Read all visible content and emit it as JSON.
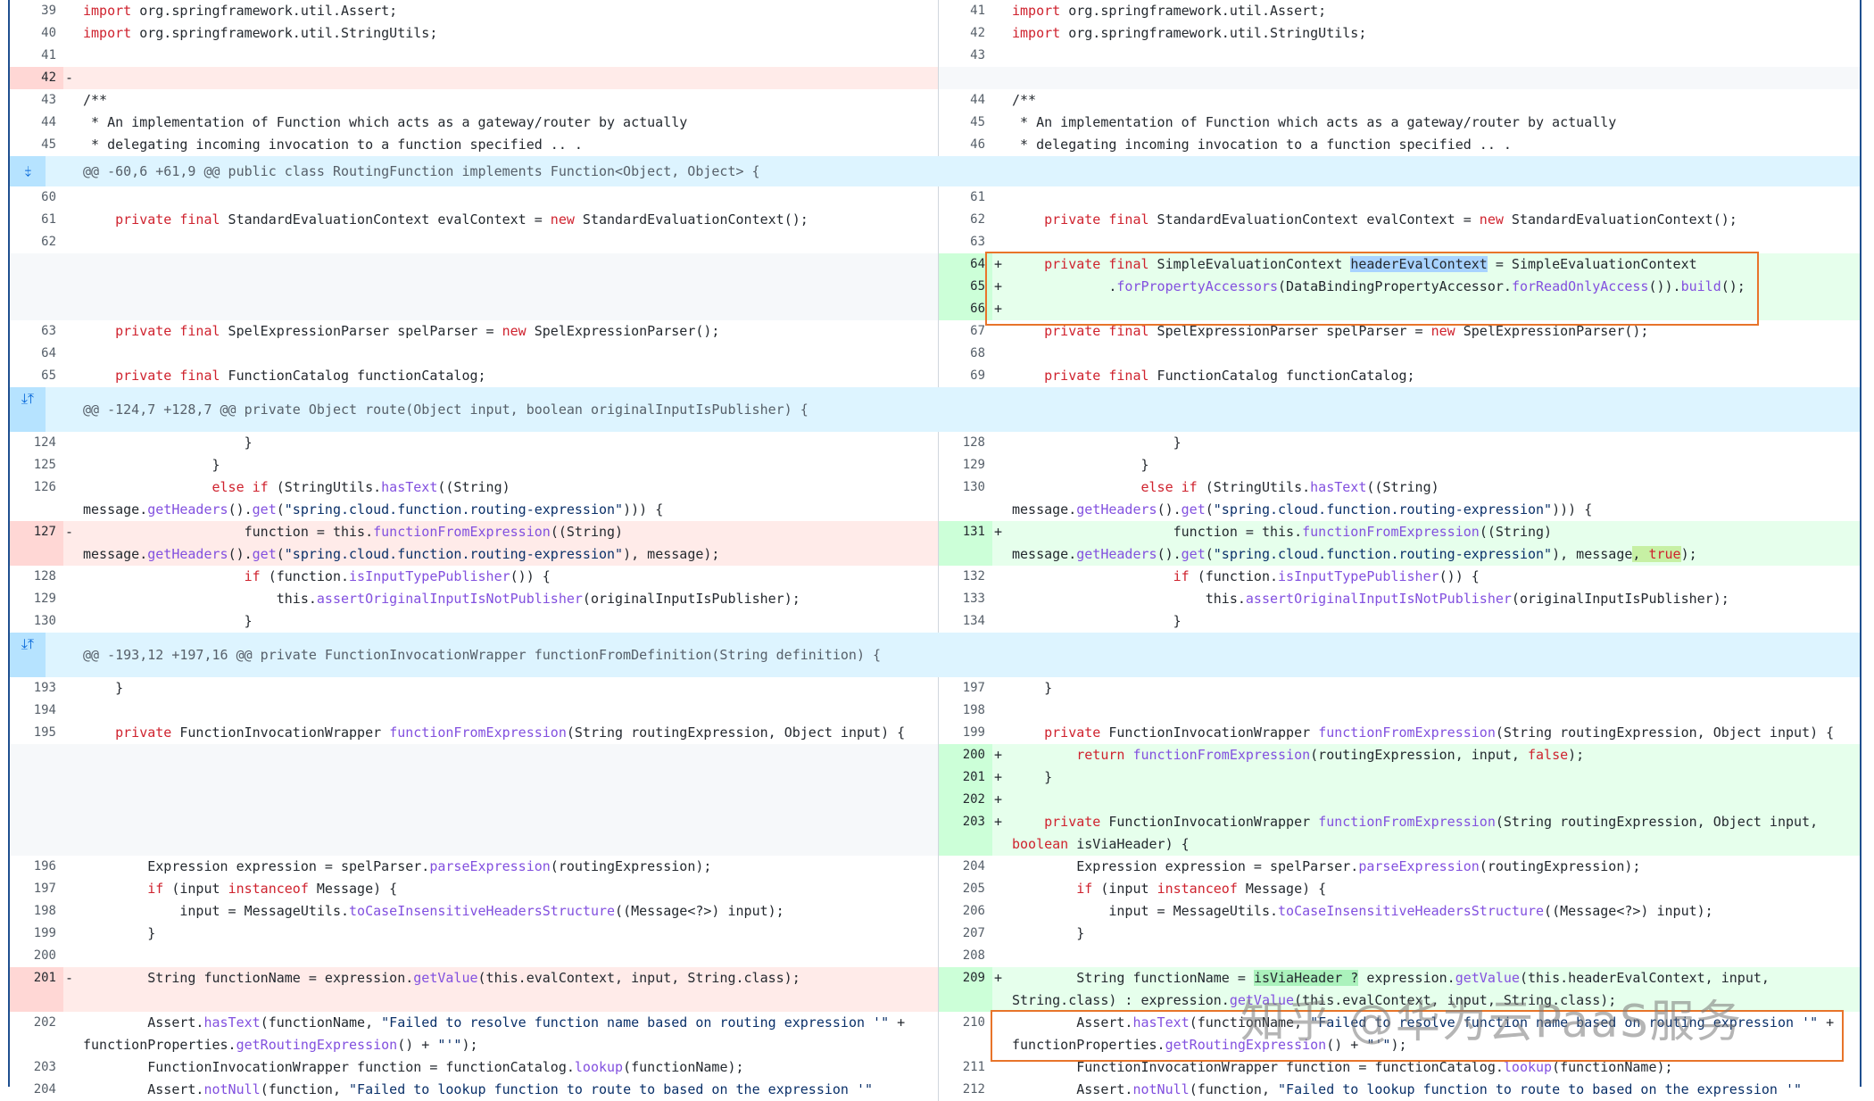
{
  "watermark": "知乎 @华为云PaaS服务",
  "colors": {
    "addition": "#e6ffec",
    "deletion": "#ffebe9",
    "hunk": "#ddf4ff",
    "highlight_box": "#e8742a"
  },
  "rows": [
    {
      "type": "code",
      "h": 25,
      "left": {
        "num": "39",
        "t": "ctx",
        "code": "import org.springframework.util.Assert;"
      },
      "right": {
        "num": "41",
        "t": "ctx",
        "code": "import org.springframework.util.Assert;"
      }
    },
    {
      "type": "code",
      "h": 25,
      "left": {
        "num": "40",
        "t": "ctx",
        "code": "import org.springframework.util.StringUtils;"
      },
      "right": {
        "num": "42",
        "t": "ctx",
        "code": "import org.springframework.util.StringUtils;"
      }
    },
    {
      "type": "code",
      "h": 25,
      "left": {
        "num": "41",
        "t": "ctx",
        "code": ""
      },
      "right": {
        "num": "43",
        "t": "ctx",
        "code": ""
      }
    },
    {
      "type": "code",
      "h": 25,
      "left": {
        "num": "42",
        "t": "del",
        "sign": "-",
        "code": ""
      },
      "right": {
        "t": "empty"
      }
    },
    {
      "type": "code",
      "h": 25,
      "left": {
        "num": "43",
        "t": "ctx",
        "code": "/**"
      },
      "right": {
        "num": "44",
        "t": "ctx",
        "code": "/**"
      }
    },
    {
      "type": "code",
      "h": 25,
      "left": {
        "num": "44",
        "t": "ctx",
        "code": " * An implementation of Function which acts as a gateway/router by actually"
      },
      "right": {
        "num": "45",
        "t": "ctx",
        "code": " * An implementation of Function which acts as a gateway/router by actually"
      }
    },
    {
      "type": "code",
      "h": 25,
      "left": {
        "num": "45",
        "t": "ctx",
        "code": " * delegating incoming invocation to a function specified .. ."
      },
      "right": {
        "num": "46",
        "t": "ctx",
        "code": " * delegating incoming invocation to a function specified .. ."
      }
    },
    {
      "type": "hunk",
      "h": 34,
      "icon": "⤈",
      "text": "@@ -60,6 +61,9 @@ public class RoutingFunction implements Function<Object, Object> {"
    },
    {
      "type": "code",
      "h": 25,
      "left": {
        "num": "60",
        "t": "ctx",
        "code": ""
      },
      "right": {
        "num": "61",
        "t": "ctx",
        "code": ""
      }
    },
    {
      "type": "code",
      "h": 25,
      "left": {
        "num": "61",
        "t": "ctx",
        "code": "    private final StandardEvaluationContext evalContext = new StandardEvaluationContext();"
      },
      "right": {
        "num": "62",
        "t": "ctx",
        "code": "    private final StandardEvaluationContext evalContext = new StandardEvaluationContext();"
      }
    },
    {
      "type": "code",
      "h": 25,
      "left": {
        "num": "62",
        "t": "ctx",
        "code": ""
      },
      "right": {
        "num": "63",
        "t": "ctx",
        "code": ""
      }
    },
    {
      "type": "code",
      "h": 25,
      "left": {
        "t": "empty"
      },
      "right": {
        "num": "64",
        "t": "add",
        "sign": "+",
        "code": "    private final SimpleEvaluationContext headerEvalContext = SimpleEvaluationContext"
      }
    },
    {
      "type": "code",
      "h": 25,
      "left": {
        "t": "empty"
      },
      "right": {
        "num": "65",
        "t": "add",
        "sign": "+",
        "code": "            .forPropertyAccessors(DataBindingPropertyAccessor.forReadOnlyAccess()).build();"
      }
    },
    {
      "type": "code",
      "h": 25,
      "left": {
        "t": "empty"
      },
      "right": {
        "num": "66",
        "t": "add",
        "sign": "+",
        "code": ""
      }
    },
    {
      "type": "code",
      "h": 25,
      "left": {
        "num": "63",
        "t": "ctx",
        "code": "    private final SpelExpressionParser spelParser = new SpelExpressionParser();"
      },
      "right": {
        "num": "67",
        "t": "ctx",
        "code": "    private final SpelExpressionParser spelParser = new SpelExpressionParser();"
      }
    },
    {
      "type": "code",
      "h": 25,
      "left": {
        "num": "64",
        "t": "ctx",
        "code": ""
      },
      "right": {
        "num": "68",
        "t": "ctx",
        "code": ""
      }
    },
    {
      "type": "code",
      "h": 25,
      "left": {
        "num": "65",
        "t": "ctx",
        "code": "    private final FunctionCatalog functionCatalog;"
      },
      "right": {
        "num": "69",
        "t": "ctx",
        "code": "    private final FunctionCatalog functionCatalog;"
      }
    },
    {
      "type": "hunk",
      "h": 50,
      "icon": "⤓⤒",
      "text": "@@ -124,7 +128,7 @@ private Object route(Object input, boolean originalInputIsPublisher) {"
    },
    {
      "type": "code",
      "h": 25,
      "left": {
        "num": "124",
        "t": "ctx",
        "code": "                    }"
      },
      "right": {
        "num": "128",
        "t": "ctx",
        "code": "                    }"
      }
    },
    {
      "type": "code",
      "h": 25,
      "left": {
        "num": "125",
        "t": "ctx",
        "code": "                }"
      },
      "right": {
        "num": "129",
        "t": "ctx",
        "code": "                }"
      }
    },
    {
      "type": "code",
      "h": 50,
      "left": {
        "num": "126",
        "t": "ctx",
        "code": "                else if (StringUtils.hasText((String) message.getHeaders().get(\"spring.cloud.function.routing-expression\"))) {"
      },
      "right": {
        "num": "130",
        "t": "ctx",
        "code": "                else if (StringUtils.hasText((String) message.getHeaders().get(\"spring.cloud.function.routing-expression\"))) {"
      }
    },
    {
      "type": "code",
      "h": 50,
      "left": {
        "num": "127",
        "t": "del",
        "sign": "-",
        "code": "                    function = this.functionFromExpression((String) message.getHeaders().get(\"spring.cloud.function.routing-expression\"), message);"
      },
      "right": {
        "num": "131",
        "t": "add",
        "sign": "+",
        "code": "                    function = this.functionFromExpression((String) message.getHeaders().get(\"spring.cloud.function.routing-expression\"), message, true);"
      }
    },
    {
      "type": "code",
      "h": 25,
      "left": {
        "num": "128",
        "t": "ctx",
        "code": "                    if (function.isInputTypePublisher()) {"
      },
      "right": {
        "num": "132",
        "t": "ctx",
        "code": "                    if (function.isInputTypePublisher()) {"
      }
    },
    {
      "type": "code",
      "h": 25,
      "left": {
        "num": "129",
        "t": "ctx",
        "code": "                        this.assertOriginalInputIsNotPublisher(originalInputIsPublisher);"
      },
      "right": {
        "num": "133",
        "t": "ctx",
        "code": "                        this.assertOriginalInputIsNotPublisher(originalInputIsPublisher);"
      }
    },
    {
      "type": "code",
      "h": 25,
      "left": {
        "num": "130",
        "t": "ctx",
        "code": "                    }"
      },
      "right": {
        "num": "134",
        "t": "ctx",
        "code": "                    }"
      }
    },
    {
      "type": "hunk",
      "h": 50,
      "icon": "⤓⤒",
      "text": "@@ -193,12 +197,16 @@ private FunctionInvocationWrapper functionFromDefinition(String definition) {"
    },
    {
      "type": "code",
      "h": 25,
      "left": {
        "num": "193",
        "t": "ctx",
        "code": "    }"
      },
      "right": {
        "num": "197",
        "t": "ctx",
        "code": "    }"
      }
    },
    {
      "type": "code",
      "h": 25,
      "left": {
        "num": "194",
        "t": "ctx",
        "code": ""
      },
      "right": {
        "num": "198",
        "t": "ctx",
        "code": ""
      }
    },
    {
      "type": "code",
      "h": 25,
      "left": {
        "num": "195",
        "t": "ctx",
        "code": "    private FunctionInvocationWrapper functionFromExpression(String routingExpression, Object input) {"
      },
      "right": {
        "num": "199",
        "t": "ctx",
        "code": "    private FunctionInvocationWrapper functionFromExpression(String routingExpression, Object input) {"
      }
    },
    {
      "type": "code",
      "h": 25,
      "left": {
        "t": "empty"
      },
      "right": {
        "num": "200",
        "t": "add",
        "sign": "+",
        "code": "        return functionFromExpression(routingExpression, input, false);"
      }
    },
    {
      "type": "code",
      "h": 25,
      "left": {
        "t": "empty"
      },
      "right": {
        "num": "201",
        "t": "add",
        "sign": "+",
        "code": "    }"
      }
    },
    {
      "type": "code",
      "h": 25,
      "left": {
        "t": "empty"
      },
      "right": {
        "num": "202",
        "t": "add",
        "sign": "+",
        "code": ""
      }
    },
    {
      "type": "code",
      "h": 50,
      "left": {
        "t": "empty"
      },
      "right": {
        "num": "203",
        "t": "add",
        "sign": "+",
        "code": "    private FunctionInvocationWrapper functionFromExpression(String routingExpression, Object input, boolean isViaHeader) {"
      }
    },
    {
      "type": "code",
      "h": 25,
      "left": {
        "num": "196",
        "t": "ctx",
        "code": "        Expression expression = spelParser.parseExpression(routingExpression);"
      },
      "right": {
        "num": "204",
        "t": "ctx",
        "code": "        Expression expression = spelParser.parseExpression(routingExpression);"
      }
    },
    {
      "type": "code",
      "h": 25,
      "left": {
        "num": "197",
        "t": "ctx",
        "code": "        if (input instanceof Message) {"
      },
      "right": {
        "num": "205",
        "t": "ctx",
        "code": "        if (input instanceof Message) {"
      }
    },
    {
      "type": "code",
      "h": 25,
      "left": {
        "num": "198",
        "t": "ctx",
        "code": "            input = MessageUtils.toCaseInsensitiveHeadersStructure((Message<?>) input);"
      },
      "right": {
        "num": "206",
        "t": "ctx",
        "code": "            input = MessageUtils.toCaseInsensitiveHeadersStructure((Message<?>) input);"
      }
    },
    {
      "type": "code",
      "h": 25,
      "left": {
        "num": "199",
        "t": "ctx",
        "code": "        }"
      },
      "right": {
        "num": "207",
        "t": "ctx",
        "code": "        }"
      }
    },
    {
      "type": "code",
      "h": 25,
      "left": {
        "num": "200",
        "t": "ctx",
        "code": ""
      },
      "right": {
        "num": "208",
        "t": "ctx",
        "code": ""
      }
    },
    {
      "type": "code",
      "h": 50,
      "left": {
        "num": "201",
        "t": "del",
        "sign": "-",
        "code": "        String functionName = expression.getValue(this.evalContext, input, String.class);"
      },
      "right": {
        "num": "209",
        "t": "add",
        "sign": "+",
        "code": "        String functionName = isViaHeader ? expression.getValue(this.headerEvalContext, input, String.class) : expression.getValue(this.evalContext, input, String.class);"
      }
    },
    {
      "type": "code",
      "h": 50,
      "left": {
        "num": "202",
        "t": "ctx",
        "code": "        Assert.hasText(functionName, \"Failed to resolve function name based on routing expression '\" + functionProperties.getRoutingExpression() + \"'\");"
      },
      "right": {
        "num": "210",
        "t": "ctx",
        "code": "        Assert.hasText(functionName, \"Failed to resolve function name based on routing expression '\" + functionProperties.getRoutingExpression() + \"'\");"
      }
    },
    {
      "type": "code",
      "h": 25,
      "left": {
        "num": "203",
        "t": "ctx",
        "code": "        FunctionInvocationWrapper function = functionCatalog.lookup(functionName);"
      },
      "right": {
        "num": "211",
        "t": "ctx",
        "code": "        FunctionInvocationWrapper function = functionCatalog.lookup(functionName);"
      }
    },
    {
      "type": "code",
      "h": 25,
      "left": {
        "num": "204",
        "t": "ctx",
        "code": "        Assert.notNull(function, \"Failed to lookup function to route to based on the expression '\""
      },
      "right": {
        "num": "212",
        "t": "ctx",
        "code": "        Assert.notNull(function, \"Failed to lookup function to route to based on the expression '\""
      }
    }
  ]
}
